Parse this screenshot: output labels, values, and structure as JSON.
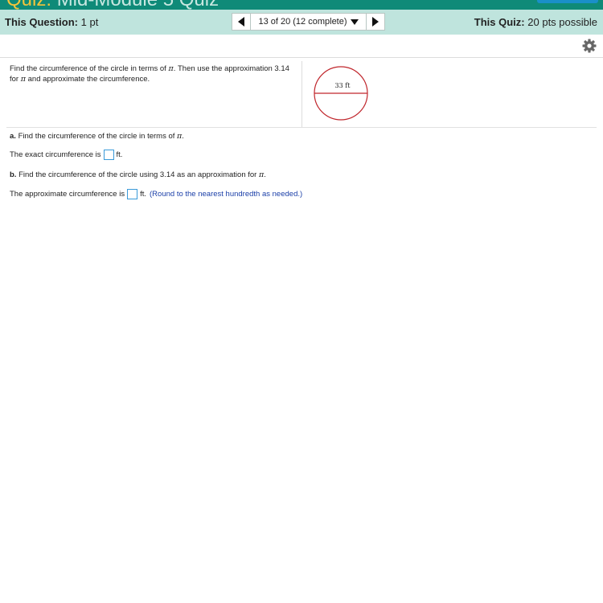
{
  "app": {
    "title_prefix": "Quiz:",
    "title": "Mid-Module 5 Quiz"
  },
  "header": {
    "question_label": "This Question:",
    "question_value": "1 pt",
    "nav_position": "13 of 20 (12 complete)",
    "quiz_label": "This Quiz:",
    "quiz_value": "20 pts possible"
  },
  "question": {
    "prompt_before_pi": "Find the circumference of the circle in terms of",
    "prompt_middle": ". Then use the approximation 3.14 for",
    "prompt_after_pi": "and approximate the circumference.",
    "pi": "π",
    "figure_label": "33 ft"
  },
  "part_a": {
    "label": "a.",
    "text": "Find the circumference of the circle in terms of",
    "pi": "π",
    "end": ".",
    "answer_prefix": "The exact circumference is",
    "answer_value": "",
    "answer_unit": "ft."
  },
  "part_b": {
    "label": "b.",
    "text": "Find the circumference of the circle using 3.14 as an approximation for",
    "pi": "π",
    "end": ".",
    "answer_prefix": "The approximate circumference is",
    "answer_value": "",
    "answer_unit": "ft.",
    "hint": "(Round to the nearest hundredth as needed.)"
  },
  "colors": {
    "header_bg": "#bfe4dd",
    "topbar_bg": "#0f8a78",
    "circle_stroke": "#c0262c",
    "input_border": "#3a9ad9",
    "hint_text": "#1b3fa8"
  },
  "icons": [
    "previous-arrow-icon",
    "dropdown-caret-icon",
    "next-arrow-icon",
    "settings-gear-icon"
  ]
}
